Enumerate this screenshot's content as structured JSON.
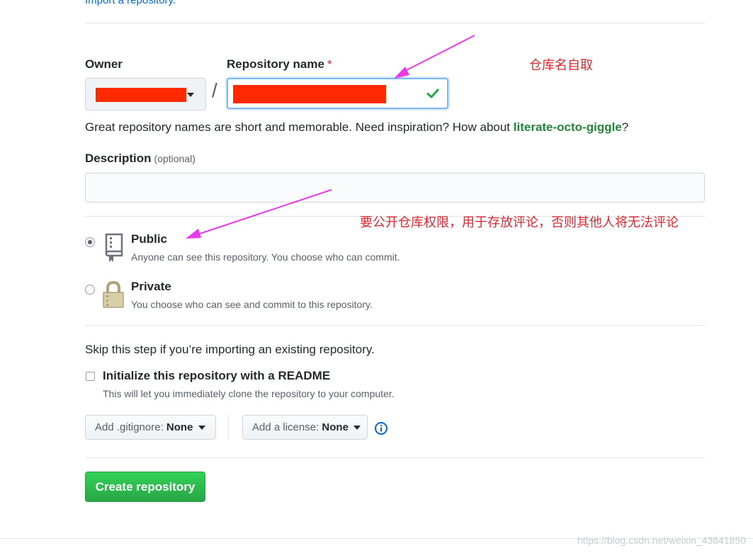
{
  "header": {
    "import_link": "Import a repository."
  },
  "owner": {
    "label": "Owner"
  },
  "repository": {
    "label": "Repository name",
    "required_marker": "*",
    "hint_prefix": "Great repository names are short and memorable. Need inspiration? How about ",
    "suggestion": "literate-octo-giggle",
    "hint_suffix": "?"
  },
  "description": {
    "label": "Description",
    "optional": "(optional)",
    "value": ""
  },
  "visibility": {
    "options": [
      {
        "title": "Public",
        "desc": "Anyone can see this repository. You choose who can commit.",
        "selected": true
      },
      {
        "title": "Private",
        "desc": "You choose who can see and commit to this repository.",
        "selected": false
      }
    ]
  },
  "init": {
    "skip_text": "Skip this step if you’re importing an existing repository.",
    "readme_label": "Initialize this repository with a README",
    "readme_desc": "This will let you immediately clone the repository to your computer.",
    "checked": false
  },
  "gitignore": {
    "prefix": "Add .gitignore:",
    "value": "None"
  },
  "license": {
    "prefix": "Add a license:",
    "value": "None"
  },
  "create_button": "Create repository",
  "annotations": {
    "repo_name_note": "仓库名自取",
    "public_note": "要公开仓库权限，用于存放评论，否则其他人将无法评论"
  },
  "watermark": "https://blog.csdn.net/weixin_43641850",
  "colors": {
    "accent_green": "#28a745",
    "annotation_red": "#e0262f",
    "arrow_magenta": "#e83ae8",
    "redaction": "#ff2a00"
  },
  "icons": {
    "check": "check-icon",
    "repo": "repo-book-icon",
    "lock": "lock-icon",
    "info": "info-icon",
    "caret": "caret-down-icon"
  }
}
